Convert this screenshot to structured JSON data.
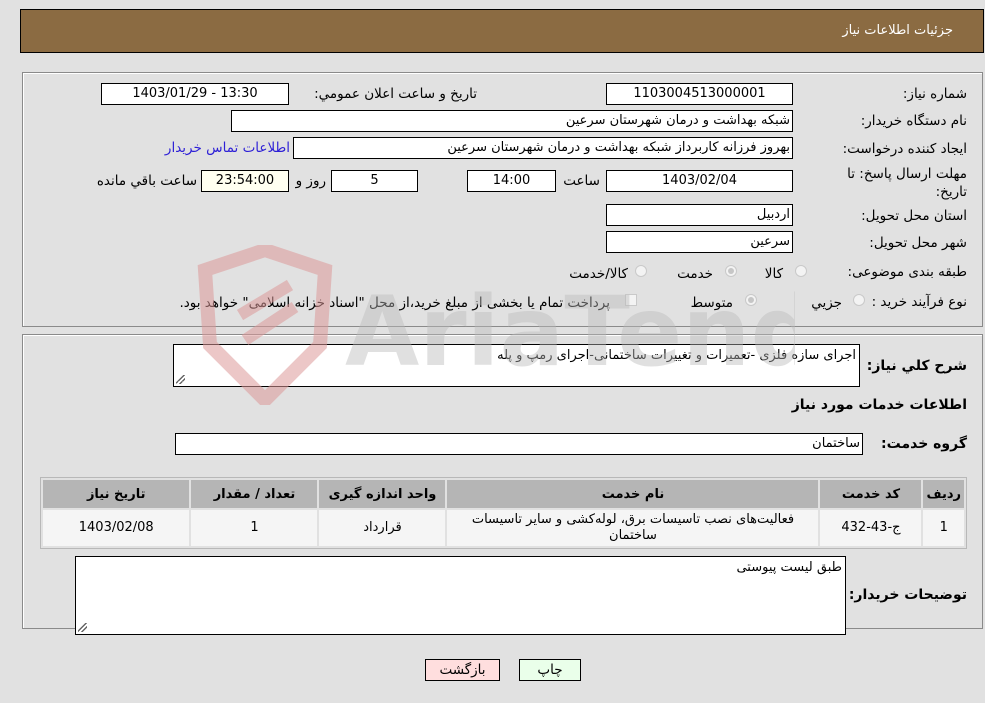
{
  "header": {
    "title": "جزئیات اطلاعات نیاز"
  },
  "details": {
    "need_number_label": "شماره نیاز:",
    "need_number": "1103004513000001",
    "announce_label": "تاریخ و ساعت اعلان عمومي:",
    "announce_value": "1403/01/29 - 13:30",
    "buyer_org_label": "نام دستگاه خريدار:",
    "buyer_org": "شبکه بهداشت و درمان شهرستان سرعين",
    "creator_label": "ایجاد کننده درخواست:",
    "creator": "بهروز فرزانه کاربرداز شبکه بهداشت و درمان شهرستان سرعین",
    "contact_link": "اطلاعات تماس خریدار",
    "deadline_label": "مهلت ارسال پاسخ: تا تاریخ:",
    "deadline_date": "1403/02/04",
    "time_label": "ساعت",
    "deadline_time": "14:00",
    "days_value": "5",
    "days_label": "روز و",
    "remaining_time": "23:54:00",
    "remaining_label": "ساعت باقي مانده",
    "province_label": "استان محل تحویل:",
    "province": "اردبیل",
    "city_label": "شهر محل تحویل:",
    "city": "سرعين",
    "category_label": "طبقه بندی موضوعی:",
    "category_options": [
      {
        "label": "کالا",
        "checked": false
      },
      {
        "label": "خدمت",
        "checked": true
      },
      {
        "label": "کالا/خدمت",
        "checked": false
      }
    ],
    "process_label": "نوع فرآیند خرید :",
    "process_options": [
      {
        "label": "جزيي",
        "checked": false
      },
      {
        "label": "متوسط",
        "checked": true
      }
    ],
    "treasury_note": "پرداخت تمام یا بخشی از مبلغ خرید،از محل \"اسناد خزانه اسلامی\" خواهد بود.",
    "treasury_checked": false
  },
  "services": {
    "description_label": "شرح كلي نياز:",
    "description": "اجرای سازه فلزی -تعمیرات و تغییرات ساختمانی-اجرای رمپ و پله",
    "section_title": "اطلاعات خدمات مورد نیاز",
    "group_label": "گروه خدمت:",
    "group_value": "ساختمان",
    "table": {
      "headers": [
        "ردیف",
        "کد خدمت",
        "نام خدمت",
        "واحد اندازه گیری",
        "تعداد / مقدار",
        "تاریخ نیاز"
      ],
      "rows": [
        [
          "1",
          "ج-43-432",
          "فعالیت‌های نصب تاسیسات برق، لوله‌کشی و سایر تاسیسات ساختمان",
          "قرارداد",
          "1",
          "1403/02/08"
        ]
      ]
    },
    "buyer_notes_label": "توضیحات خریدار:",
    "buyer_notes": "طبق لیست پیوستی"
  },
  "buttons": {
    "print": "چاپ",
    "back": "بازگشت"
  },
  "watermark": {
    "text": "AriaTender.neT"
  }
}
